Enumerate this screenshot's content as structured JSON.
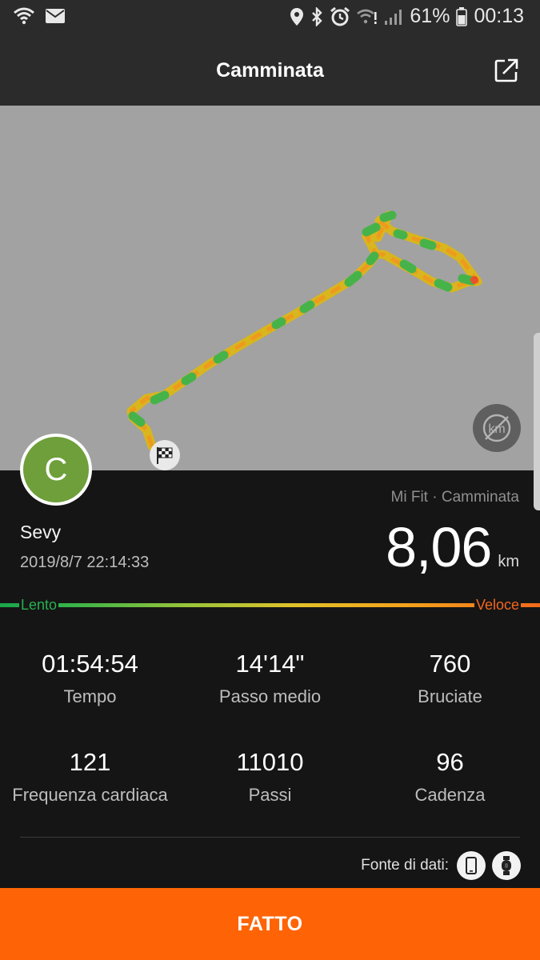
{
  "status_bar": {
    "battery": "61%",
    "time": "00:13",
    "icons": [
      "wifi-icon",
      "mail-icon",
      "location-icon",
      "bluetooth-icon",
      "alarm-icon",
      "wifi-calling-icon",
      "signal-icon",
      "battery-icon"
    ]
  },
  "header": {
    "title": "Camminata",
    "share_icon": "share-icon"
  },
  "map": {
    "finish_icon": "checkered-flag-icon",
    "unit_toggle_icon": "km-toggle-icon"
  },
  "profile": {
    "avatar_initial": "C",
    "name": "Sevy",
    "datetime": "2019/8/7 22:14:33",
    "avatar_color": "#6e9f3a"
  },
  "summary": {
    "source": "Mi Fit · Camminata",
    "distance": "8,06",
    "unit": "km"
  },
  "speed_scale": {
    "slow": "Lento",
    "fast": "Veloce",
    "slow_color": "#28b14f",
    "fast_color": "#f3661f"
  },
  "stats": [
    {
      "value": "01:54:54",
      "label": "Tempo"
    },
    {
      "value": "14'14\"",
      "label": "Passo medio"
    },
    {
      "value": "760",
      "label": "Bruciate"
    },
    {
      "value": "121",
      "label": "Frequenza cardiaca"
    },
    {
      "value": "11010",
      "label": "Passi"
    },
    {
      "value": "96",
      "label": "Cadenza"
    }
  ],
  "data_source": {
    "label": "Fonte di dati:",
    "icons": [
      "phone-icon",
      "band-icon"
    ]
  },
  "footer": {
    "done_label": "FATTO",
    "accent": "#fe6406"
  }
}
